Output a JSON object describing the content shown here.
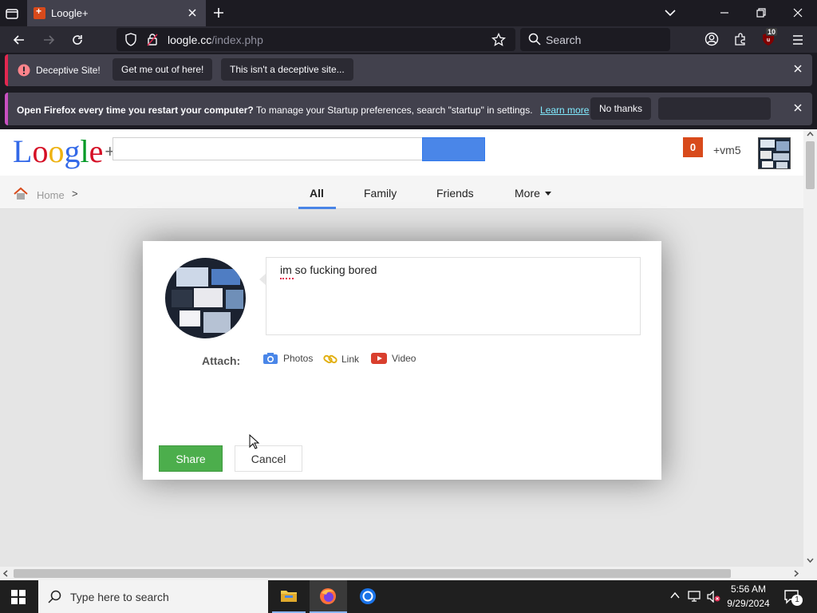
{
  "browser": {
    "tab_title": "Loogle+",
    "url_host": "loogle.cc",
    "url_path": "/index.php",
    "search_placeholder": "Search",
    "extension_badge": "10"
  },
  "notifications": {
    "deceptive": {
      "label": "Deceptive Site!",
      "get_out": "Get me out of here!",
      "not_deceptive": "This isn't a deceptive site..."
    },
    "startup": {
      "bold": "Open Firefox every time you restart your computer?",
      "text": " To manage your Startup preferences, search \"startup\" in settings.",
      "learn_more": "Learn more",
      "no_thanks": "No thanks"
    }
  },
  "site": {
    "logo_letters": [
      "L",
      "o",
      "o",
      "g",
      "l",
      "e"
    ],
    "logo_plus": "+",
    "notification_count": "0",
    "user_handle": "+vm5",
    "breadcrumb": {
      "home": "Home",
      "separator": ">"
    },
    "tabs": [
      "All",
      "Family",
      "Friends",
      "More"
    ],
    "active_tab": "All"
  },
  "modal": {
    "post_text": "im so fucking bored",
    "attach_label": "Attach:",
    "attach_options": [
      "Photos",
      "Link",
      "Video"
    ],
    "share_label": "Share",
    "cancel_label": "Cancel"
  },
  "taskbar": {
    "search_placeholder": "Type here to search",
    "time": "5:56 AM",
    "date": "9/29/2024",
    "notification_count": "1"
  },
  "colors": {
    "accent_blue": "#4a86e8",
    "share_green": "#4cae4c",
    "badge_orange": "#d84a1b",
    "deceptive_red": "#e22850"
  }
}
